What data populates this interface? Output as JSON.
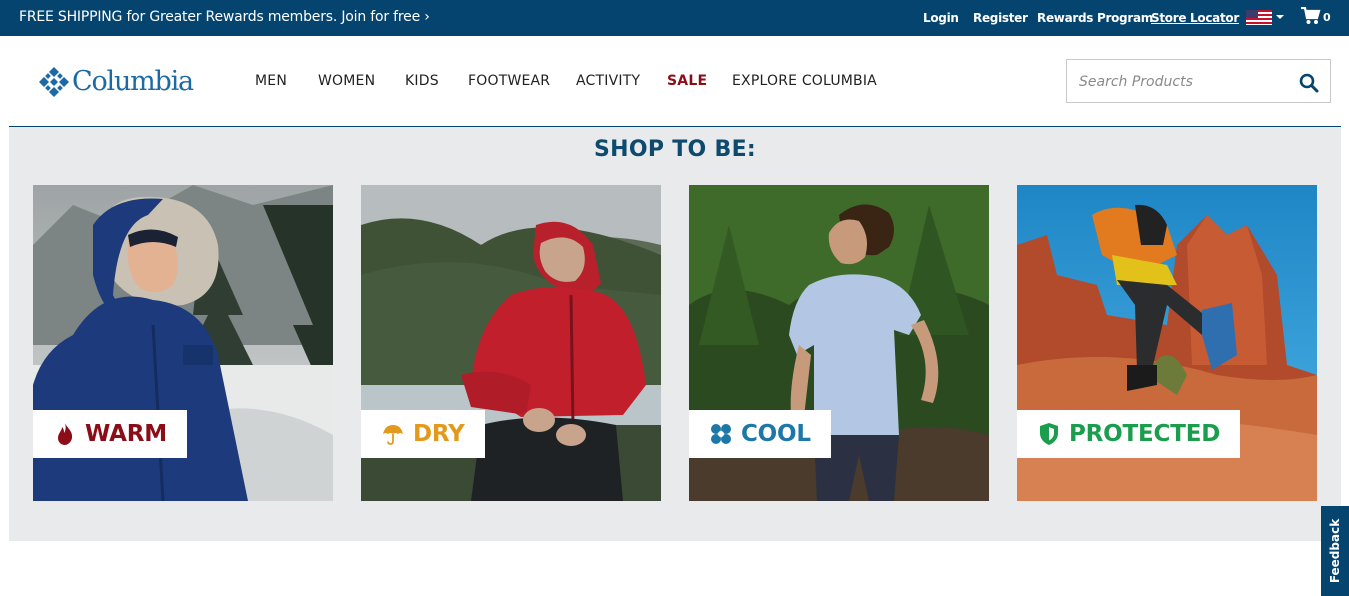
{
  "topbar": {
    "promo": "FREE SHIPPING for Greater Rewards members. Join for free ›",
    "links": [
      "Login",
      "Register",
      "Rewards Program",
      "Store Locator"
    ],
    "cart_count": "0",
    "background": "#05446e"
  },
  "header": {
    "logo_text": "Columbia",
    "nav": [
      "MEN",
      "WOMEN",
      "KIDS",
      "FOOTWEAR",
      "ACTIVITY",
      "SALE",
      "EXPLORE COLUMBIA"
    ],
    "search_placeholder": "Search Products",
    "brand_color": "#1b6aa6",
    "sale_color": "#8a0d18"
  },
  "main": {
    "title": "SHOP TO BE:",
    "tiles": [
      {
        "label": "WARM",
        "icon": "flame-icon",
        "color": "#8a0d18"
      },
      {
        "label": "DRY",
        "icon": "umbrella-icon",
        "color": "#e39a1c"
      },
      {
        "label": "COOL",
        "icon": "cooling-icon",
        "color": "#1d78a8"
      },
      {
        "label": "PROTECTED",
        "icon": "shield-icon",
        "color": "#1a9d4c"
      }
    ]
  },
  "feedback": "Feedback"
}
